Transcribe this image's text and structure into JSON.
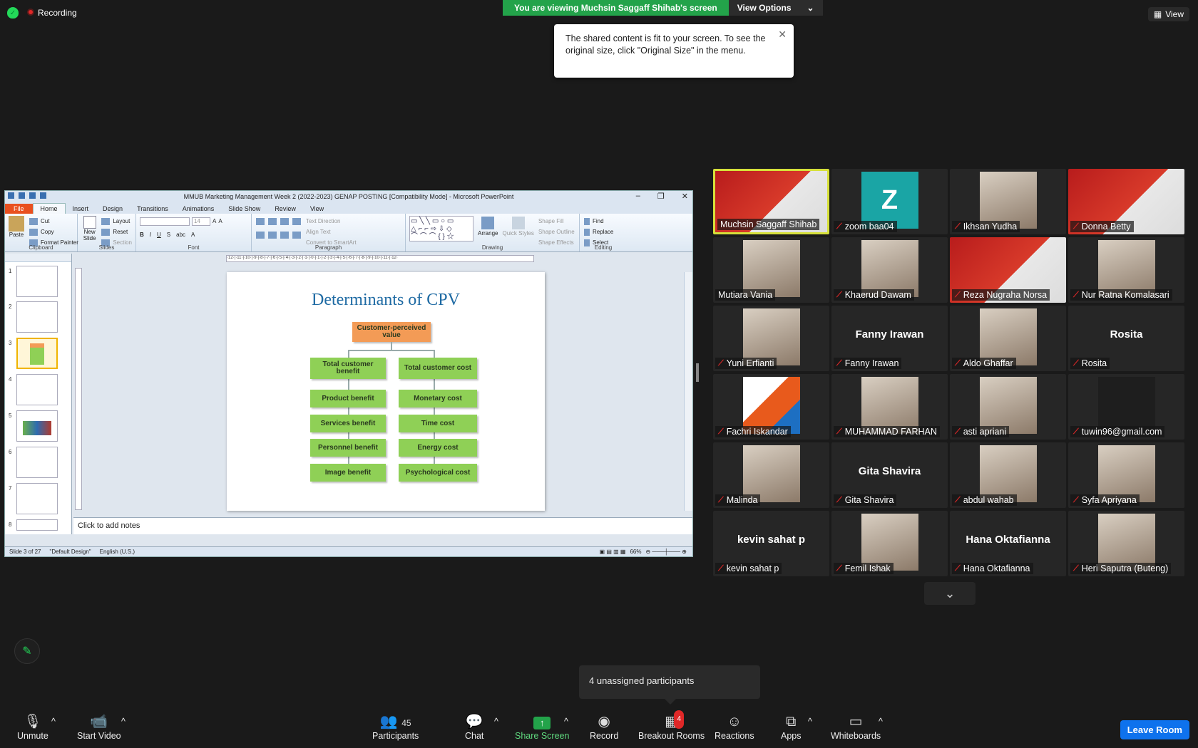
{
  "top": {
    "recording_label": "Recording",
    "banner_text": "You are viewing Muchsin Saggaff Shihab's screen",
    "view_options_label": "View Options",
    "view_label": "View"
  },
  "tooltip": {
    "text": "The shared content is fit to your screen. To see the original size, click \"Original Size\" in the menu."
  },
  "ppt": {
    "title": "MMUB Marketing Management Week 2 (2022-2023) GENAP POSTING [Compatibility Mode] - Microsoft PowerPoint",
    "tabs": [
      "File",
      "Home",
      "Insert",
      "Design",
      "Transitions",
      "Animations",
      "Slide Show",
      "Review",
      "View"
    ],
    "ribbon": {
      "clipboard": {
        "paste": "Paste",
        "cut": "Cut",
        "copy": "Copy",
        "format_painter": "Format Painter",
        "label": "Clipboard"
      },
      "slides": {
        "new_slide": "New Slide",
        "layout": "Layout",
        "reset": "Reset",
        "section": "Section",
        "label": "Slides"
      },
      "font": {
        "size": "14",
        "label": "Font"
      },
      "paragraph": {
        "text_direction": "Text Direction",
        "align_text": "Align Text",
        "convert": "Convert to SmartArt",
        "label": "Paragraph"
      },
      "drawing": {
        "arrange": "Arrange",
        "quick_styles": "Quick Styles",
        "shape_fill": "Shape Fill",
        "shape_outline": "Shape Outline",
        "shape_effects": "Shape Effects",
        "label": "Drawing"
      },
      "editing": {
        "find": "Find",
        "replace": "Replace",
        "select": "Select",
        "label": "Editing"
      }
    },
    "ruler": "·12·|·11·|·10·|·9·|·8·|·7·|·6·|·5·|·4·|·3·|·2·|·1·|·0·|·1·|·2·|·3·|·4·|·5·|·6·|·7·|·8·|·9·|·10·|·11·|·12·",
    "thumb_numbers": [
      "1",
      "2",
      "3",
      "4",
      "5",
      "6",
      "7",
      "8"
    ],
    "slide": {
      "title": "Determinants of CPV",
      "top_box": "Customer-perceived value",
      "left_col": [
        "Total customer benefit",
        "Product benefit",
        "Services benefit",
        "Personnel benefit",
        "Image benefit"
      ],
      "right_col": [
        "Total customer cost",
        "Monetary cost",
        "Time cost",
        "Energy cost",
        "Psychological cost"
      ]
    },
    "notes_placeholder": "Click to add notes",
    "status": {
      "slide": "Slide 3 of 27",
      "theme": "\"Default Design\"",
      "language": "English (U.S.)",
      "zoom": "66%"
    }
  },
  "participants": [
    {
      "name": "Muchsin Saggaff Shihab",
      "muted": false,
      "kind": "slide"
    },
    {
      "name": "zoom baa04",
      "muted": true,
      "kind": "avatar",
      "initial": "Z"
    },
    {
      "name": "Ikhsan Yudha",
      "muted": true,
      "kind": "photo"
    },
    {
      "name": "Donna Betty",
      "muted": true,
      "kind": "slide"
    },
    {
      "name": "Mutiara Vania",
      "muted": false,
      "kind": "photo"
    },
    {
      "name": "Khaerud Dawam",
      "muted": true,
      "kind": "photo"
    },
    {
      "name": "Reza Nugraha Norsa",
      "muted": true,
      "kind": "slide"
    },
    {
      "name": "Nur Ratna Komalasari",
      "muted": true,
      "kind": "photo"
    },
    {
      "name": "Yuni Erfianti",
      "muted": true,
      "kind": "photo"
    },
    {
      "name": "Fanny Irawan",
      "muted": true,
      "kind": "text"
    },
    {
      "name": "Aldo Ghaffar",
      "muted": true,
      "kind": "photo"
    },
    {
      "name": "Rosita",
      "muted": true,
      "kind": "text"
    },
    {
      "name": "Fachri Iskandar",
      "muted": true,
      "kind": "logo"
    },
    {
      "name": "MUHAMMAD FARHAN",
      "muted": true,
      "kind": "photo"
    },
    {
      "name": "asti apriani",
      "muted": true,
      "kind": "photo"
    },
    {
      "name": "tuwin96@gmail.com",
      "muted": true,
      "kind": "dark"
    },
    {
      "name": "Malinda",
      "muted": true,
      "kind": "photo"
    },
    {
      "name": "Gita Shavira",
      "muted": true,
      "kind": "text"
    },
    {
      "name": "abdul wahab",
      "muted": true,
      "kind": "photo"
    },
    {
      "name": "Syfa Apriyana",
      "muted": true,
      "kind": "photo"
    },
    {
      "name": "kevin sahat p",
      "muted": true,
      "kind": "text"
    },
    {
      "name": "Femil Ishak",
      "muted": true,
      "kind": "photo"
    },
    {
      "name": "Hana Oktafianna",
      "muted": true,
      "kind": "text"
    },
    {
      "name": "Heri Saputra (Buteng)",
      "muted": true,
      "kind": "photo"
    }
  ],
  "unassigned_text": "4 unassigned participants",
  "toolbar": {
    "unmute": "Unmute",
    "start_video": "Start Video",
    "participants": "Participants",
    "participants_count": "45",
    "chat": "Chat",
    "share_screen": "Share Screen",
    "record": "Record",
    "breakout_rooms": "Breakout Rooms",
    "breakout_badge": "4",
    "reactions": "Reactions",
    "apps": "Apps",
    "whiteboards": "Whiteboards",
    "leave": "Leave Room"
  },
  "colors": {
    "green": "#23a34a",
    "blue": "#0e72ed",
    "red": "#e02828",
    "slide_title": "#1e6aa3",
    "box_green": "#8fd056",
    "box_orange": "#f39b56"
  }
}
